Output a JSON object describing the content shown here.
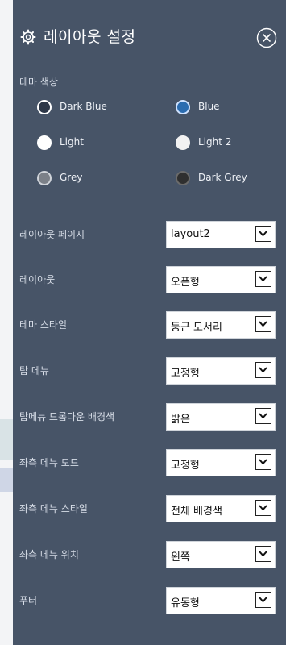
{
  "header": {
    "title": "레이아웃 설정",
    "icons": {
      "settings": "gear-icon",
      "close": "close-circle-icon"
    }
  },
  "theme": {
    "label": "테마 색상",
    "options": [
      {
        "label": "Dark Blue",
        "color": "#2d3748",
        "border": "#1a202c"
      },
      {
        "label": "Blue",
        "color": "#2b6cb0",
        "border": "#cfe2ff"
      },
      {
        "label": "Light",
        "color": "#ffffff",
        "border": "#ffffff"
      },
      {
        "label": "Light 2",
        "color": "#f2f2f2",
        "border": "#f2f2f2"
      },
      {
        "label": "Grey",
        "color": "#7b8088",
        "border": "#d0d4da"
      },
      {
        "label": "Dark Grey",
        "color": "#2f2f2f",
        "border": "#1f1f1f"
      }
    ]
  },
  "settings": [
    {
      "label": "레이아웃 페이지",
      "value": "layout2"
    },
    {
      "label": "레이아웃",
      "value": "오픈형"
    },
    {
      "label": "테마 스타일",
      "value": "둥근 모서리"
    },
    {
      "label": "탑 메뉴",
      "value": "고정형"
    },
    {
      "label": "탑메뉴 드롭다운 배경색",
      "value": "밝은"
    },
    {
      "label": "좌측 메뉴 모드",
      "value": "고정형"
    },
    {
      "label": "좌측 메뉴 스타일",
      "value": "전체 배경색"
    },
    {
      "label": "좌측 메뉴 위치",
      "value": "왼쪽"
    },
    {
      "label": "푸터",
      "value": "유동형"
    }
  ],
  "colors": {
    "panel_bg": "#475467",
    "text": "#ffffff",
    "muted_text": "#d7dde7"
  }
}
